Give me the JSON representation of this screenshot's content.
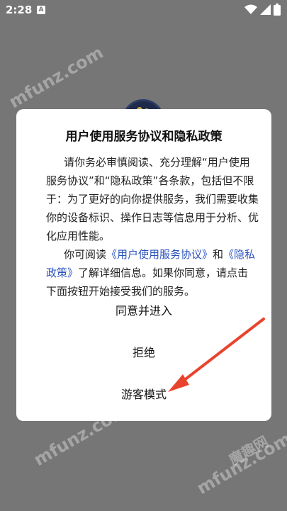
{
  "status_bar": {
    "time": "2:28",
    "notification_icon": "A",
    "icons": [
      "wifi-icon",
      "signal-icon",
      "battery-icon"
    ]
  },
  "dialog": {
    "title": "用户使用服务协议和隐私政策",
    "para1": "请你务必审慎阅读、充分理解“用户使用服务协议”和“隐私政策”各条款，包括但不限于：为了更好的向你提供服务，我们需要收集你的设备标识、操作日志等信息用于分析、优化应用性能。",
    "para2_prefix": "你可阅读",
    "link_service": "《用户使用服务协议》",
    "para2_and": "和",
    "link_privacy": "《隐私政策》",
    "para2_suffix": "了解详细信息。如果你同意，请点击下面按钮开始接受我们的服务。",
    "agree_button": "同意并进入",
    "reject_button": "拒绝",
    "guest_button": "游客模式"
  },
  "watermark": {
    "site": "mfunz.com",
    "brand": "魔趣网"
  },
  "colors": {
    "overlay": "#767676",
    "link": "#2a52be",
    "arrow": "#e8442d"
  }
}
